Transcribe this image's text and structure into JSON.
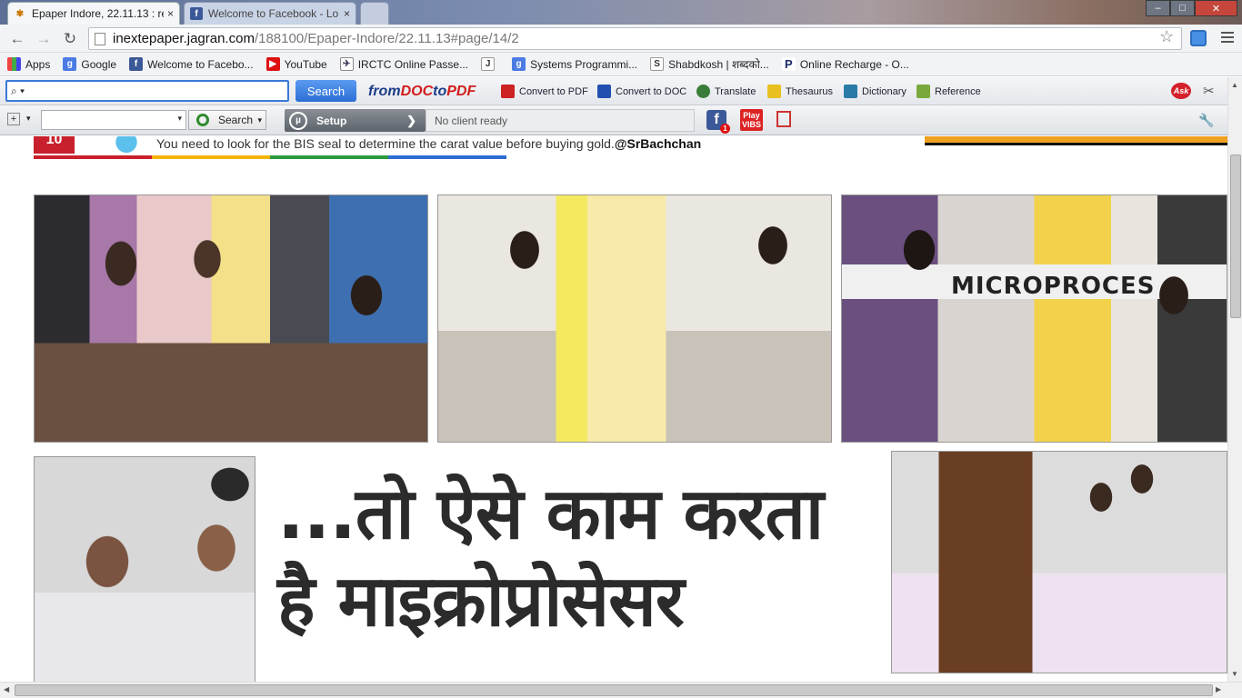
{
  "tabs": [
    {
      "title": "Epaper Indore, 22.11.13 : re",
      "close": "×"
    },
    {
      "title": "Welcome to Facebook - Lo",
      "close": "×"
    }
  ],
  "window_controls": {
    "min": "–",
    "max": "□",
    "close": "✕"
  },
  "address": {
    "host": "inextepaper.jagran.com",
    "path": "/188100/Epaper-Indore/22.11.13#page/14/2"
  },
  "bookmarks": [
    {
      "label": "Apps",
      "icon": "apps-icon"
    },
    {
      "label": "Google",
      "icon": "google-icon"
    },
    {
      "label": "Welcome to Facebo...",
      "icon": "facebook-icon"
    },
    {
      "label": "YouTube",
      "icon": "youtube-icon"
    },
    {
      "label": "IRCTC Online Passe...",
      "icon": "irctc-icon"
    },
    {
      "label": "",
      "icon": "j-icon"
    },
    {
      "label": "Systems Programmi...",
      "icon": "google-icon"
    },
    {
      "label": "Shabdkosh | शब्दको...",
      "icon": "s-icon"
    },
    {
      "label": "Online Recharge - O...",
      "icon": "paytm-icon"
    }
  ],
  "ask_toolbar": {
    "search_label": "Search",
    "fromdoc_a": "from",
    "fromdoc_b": "DOC",
    "fromdoc_c": "to",
    "fromdoc_d": "PDF",
    "items": [
      "Convert to PDF",
      "Convert to DOC",
      "Translate",
      "Thesaurus",
      "Dictionary",
      "Reference"
    ],
    "ask_logo": "Ask"
  },
  "utorrent_bar": {
    "search_label": "Search",
    "setup_label": "Setup",
    "status": "No client ready",
    "fb_count": "1",
    "play_label": "Play",
    "play_sub": "VIBS"
  },
  "page": {
    "banner_tweet": "You need to look for the BIS seal to determine the carat value before buying gold.",
    "banner_handle": "@SrBachchan",
    "banner_num": "10",
    "photo_sign": "MICROPROCES",
    "headline_line1": "...तो ऐसे काम करता",
    "headline_line2": "है माइक्रोप्रोसेसर"
  },
  "colors": {
    "tab_active": "#f5f6f8",
    "ask_search": "#2c6ed5",
    "utorrent_setup": "#5d636b",
    "headline": "#2b2b2b"
  }
}
